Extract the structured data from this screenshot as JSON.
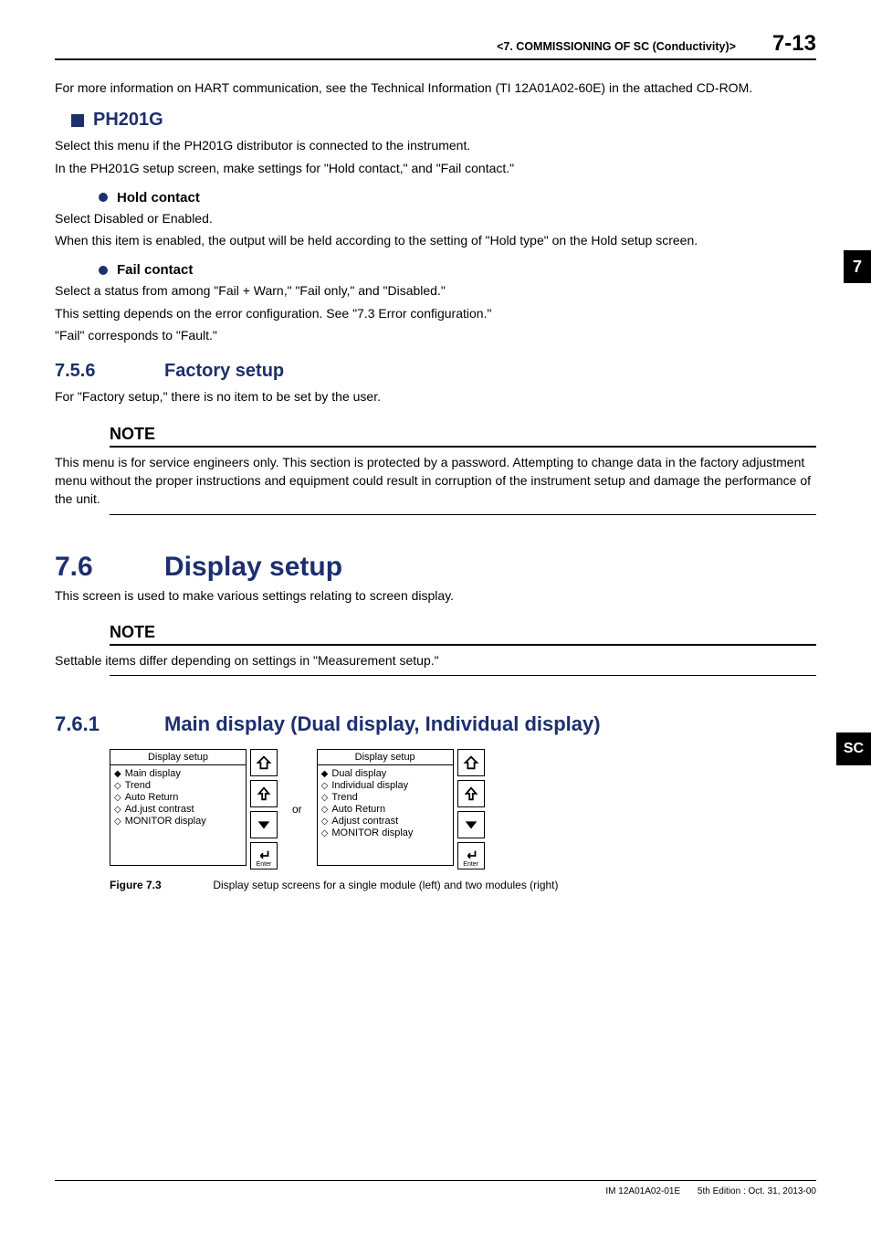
{
  "header": {
    "chapter": "<7.  COMMISSIONING OF SC (Conductivity)>",
    "page_number": "7-13"
  },
  "tabs": {
    "section": "7",
    "domain": "SC"
  },
  "intro_para": "For more information on HART communication, see the Technical Information (TI 12A01A02-60E) in the attached CD-ROM.",
  "ph201g": {
    "heading": "PH201G",
    "p1": "Select this menu if the PH201G distributor is connected to the instrument.",
    "p2": "In the PH201G setup screen, make settings for \"Hold contact,\" and \"Fail contact.\""
  },
  "hold_contact": {
    "heading": "Hold contact",
    "p1": "Select Disabled or Enabled.",
    "p2": "When this item is enabled, the output will be held according to the setting of \"Hold type\" on the Hold setup screen."
  },
  "fail_contact": {
    "heading": "Fail contact",
    "p1": "Select a status from among \"Fail + Warn,\" \"Fail only,\" and \"Disabled.\"",
    "p2": "This setting depends on the error configuration. See \"7.3 Error configuration.\"",
    "p3": "\"Fail\" corresponds to \"Fault.\""
  },
  "sec_756": {
    "num": "7.5.6",
    "title": "Factory setup",
    "p1": "For \"Factory setup,\" there is no item to be set by the user.",
    "note_label": "NOTE",
    "note_body": "This menu is for service engineers only. This section is protected by a password. Attempting to change data in the factory adjustment menu without the proper instructions and equipment could result in corruption of the instrument setup and damage the performance of the unit."
  },
  "sec_76": {
    "num": "7.6",
    "title": "Display setup",
    "p1": "This screen is used to make various settings relating to screen display.",
    "note_label": "NOTE",
    "note_body": "Settable items differ depending on settings in \"Measurement setup.\""
  },
  "sec_761": {
    "num": "7.6.1",
    "title": "Main display (Dual display, Individual display)"
  },
  "figure": {
    "or": "or",
    "enter": "Enter",
    "left": {
      "title": "Display setup",
      "items": [
        "Main display",
        "Trend",
        "Auto Return",
        "Ad.just contrast",
        "MONITOR display"
      ]
    },
    "right": {
      "title": "Display setup",
      "items": [
        "Dual display",
        "Individual display",
        "Trend",
        "Auto Return",
        "Adjust contrast",
        "MONITOR display"
      ]
    },
    "caption_label": "Figure 7.3",
    "caption_text": "Display setup screens for a single module (left) and two modules (right)"
  },
  "footer": {
    "doc_id": "IM 12A01A02-01E",
    "edition": "5th Edition : Oct. 31, 2013-00"
  }
}
